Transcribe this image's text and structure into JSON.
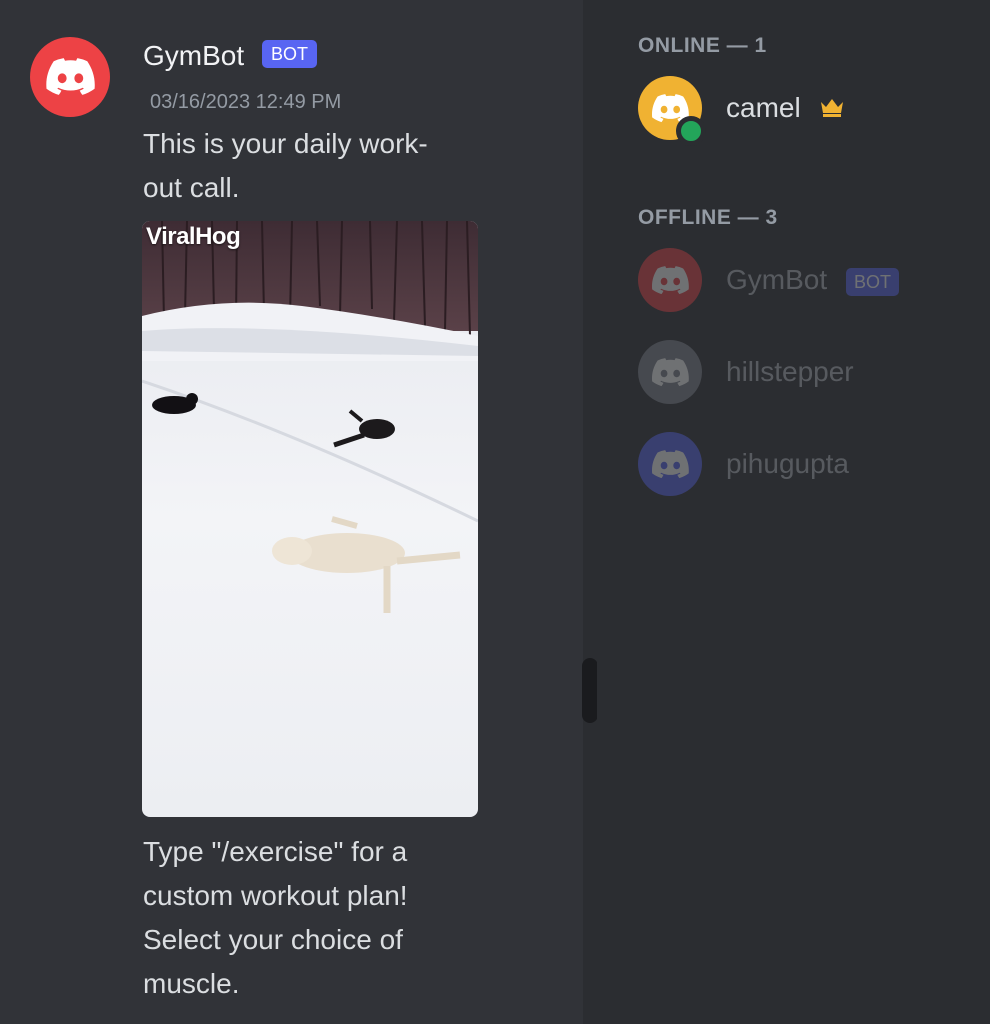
{
  "colors": {
    "background": "#313338",
    "sidebar": "#2b2d31",
    "blurple": "#5865f2",
    "gymbot_avatar": "#ed4245",
    "camel_avatar": "#f0b232",
    "hillstepper_avatar": "#80848e",
    "pihugupta_avatar": "#5865f2",
    "online_status": "#23a55a",
    "crown": "#f0b232"
  },
  "message": {
    "author": "GymBot",
    "bot_tag": "BOT",
    "avatar_icon": "discord-logo-icon",
    "timestamp": "03/16/2023 12:49 PM",
    "text_top": "This is your daily work-\nout call.",
    "video_watermark": "ViralHog",
    "text_bottom": "Type \"/exercise\" for a\ncustom workout plan!\nSelect your choice of\nmuscle."
  },
  "member_list": {
    "online_header": "ONLINE — 1",
    "offline_header": "OFFLINE — 3",
    "online": [
      {
        "name": "camel",
        "avatar_icon": "discord-logo-icon",
        "status": "online",
        "owner_icon": "crown-icon"
      }
    ],
    "offline": [
      {
        "name": "GymBot",
        "bot_tag": "BOT",
        "avatar_icon": "discord-logo-icon"
      },
      {
        "name": "hillstepper",
        "avatar_icon": "discord-logo-icon"
      },
      {
        "name": "pihugupta",
        "avatar_icon": "discord-logo-icon"
      }
    ]
  }
}
